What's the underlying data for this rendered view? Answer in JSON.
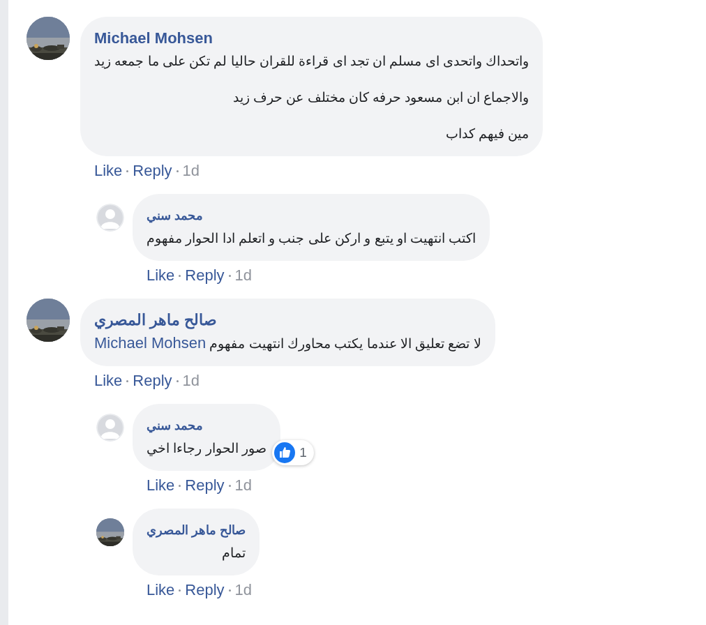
{
  "comments": [
    {
      "author": "Michael Mohsen",
      "paragraphs": [
        {
          "text": "واتحداك واتحدى اى مسلم ان تجد اى قراءة للقران حاليا لم تكن على ما جمعه زيد"
        },
        {
          "text": "والاجماع ان ابن مسعود حرفه كان مختلف عن حرف زيد"
        },
        {
          "text": "مين فيهم كداب"
        }
      ],
      "actions": {
        "like": "Like",
        "reply": "Reply",
        "time": "1d"
      },
      "replies": [
        {
          "author": "محمد سني",
          "kind": "default",
          "paragraphs": [
            {
              "text": "اكتب انتهيت او يتبع و اركن على جنب و اتعلم ادا الحوار مفهوم"
            }
          ],
          "actions": {
            "like": "Like",
            "reply": "Reply",
            "time": "1d"
          }
        }
      ]
    },
    {
      "author": "صالح ماهر المصري",
      "paragraphs": [
        {
          "text": "لا تضع تعليق الا عندما يكتب محاورك انتهيت مفهوم",
          "mention": "Michael Mohsen"
        }
      ],
      "actions": {
        "like": "Like",
        "reply": "Reply",
        "time": "1d"
      },
      "replies": [
        {
          "author": "محمد سني",
          "kind": "default",
          "paragraphs": [
            {
              "text": "صور الحوار رجاءا اخي"
            }
          ],
          "reaction": {
            "count": "1"
          },
          "actions": {
            "like": "Like",
            "reply": "Reply",
            "time": "1d"
          }
        },
        {
          "author": "صالح ماهر المصري",
          "paragraphs": [
            {
              "text": "تمام"
            }
          ],
          "actions": {
            "like": "Like",
            "reply": "Reply",
            "time": "1d"
          }
        }
      ]
    }
  ]
}
